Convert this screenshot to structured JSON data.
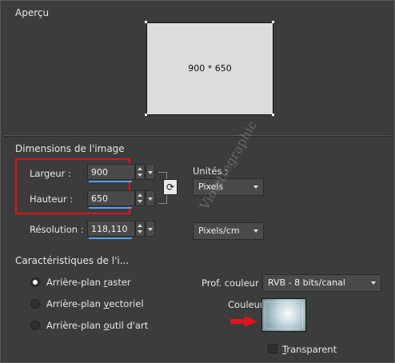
{
  "preview": {
    "section_title": "Aperçu",
    "size_label": "900 * 650"
  },
  "dimensions": {
    "section_title": "Dimensions de l'image",
    "width_label": "Largeur :",
    "width_value": "900",
    "height_label": "Hauteur :",
    "height_value": "650",
    "resolution_label": "Résolution :",
    "resolution_value": "118,110",
    "units_label": "Unités :",
    "units_selected": "Pixels",
    "resolution_units_selected": "Pixels/cm"
  },
  "characteristics": {
    "section_title": "Caractéristiques de l'i...",
    "raster_label_prefix": "Arrière-plan ",
    "raster_label_underlined": "r",
    "raster_label_suffix": "aster",
    "vector_label_prefix": "Arrière-plan ",
    "vector_label_underlined": "v",
    "vector_label_suffix": "ectoriel",
    "art_label_prefix": "Arrière-plan ",
    "art_label_underlined": "o",
    "art_label_suffix": "util d'art",
    "selected_background": "raster",
    "color_depth_label": "Prof. couleur :",
    "color_depth_value": "RVB - 8 bits/canal",
    "color_label": "Couleur :",
    "transparent_label_underlined": "T",
    "transparent_label_suffix": "ransparent",
    "transparent_checked": false
  },
  "watermark_text": "Violettegraphic",
  "colors": {
    "highlight_box": "#e0141b",
    "arrow": "#e0141b",
    "accent_underline": "#4aa3ff"
  }
}
